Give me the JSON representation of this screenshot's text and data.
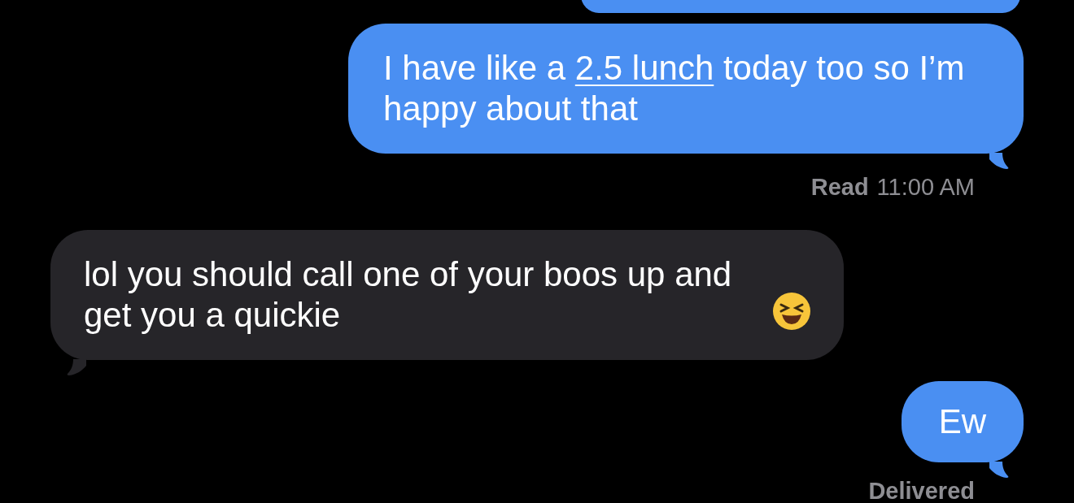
{
  "messages": [
    {
      "kind": "clipped"
    },
    {
      "kind": "sent",
      "segments": [
        {
          "text": "I have like a "
        },
        {
          "text": "2.5 lunch",
          "kind": "link"
        },
        {
          "text": " today too so I’m happy about that"
        }
      ],
      "receipt": {
        "label": "Read",
        "time": "11:00 AM"
      }
    },
    {
      "kind": "received",
      "segments": [
        {
          "text": "lol you should call one of your boos up and get you a quickie"
        }
      ],
      "emoji": true
    },
    {
      "kind": "sent",
      "segments": [
        {
          "text": "Ew"
        }
      ],
      "receipt": {
        "label": "Delivered"
      }
    }
  ]
}
